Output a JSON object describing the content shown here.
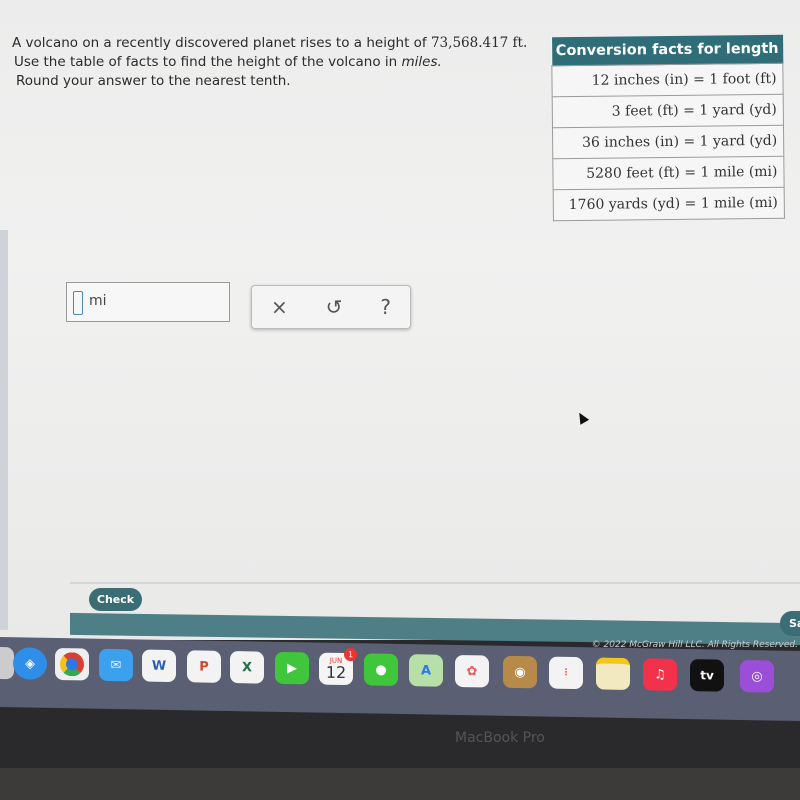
{
  "question": {
    "line1_pre": "A volcano on a recently discovered planet rises to a height of ",
    "height": "73,568.417 ft.",
    "line2_pre": "Use the table of facts to find the height of the volcano in ",
    "line2_unit": "miles.",
    "line3": "Round your answer to the nearest tenth."
  },
  "table": {
    "header": "Conversion facts for length",
    "rows": [
      "12 inches (in) = 1 foot (ft)",
      "3 feet (ft) = 1 yard (yd)",
      "36 inches (in) = 1 yard (yd)",
      "5280 feet (ft) = 1 mile (mi)",
      "1760 yards (yd) = 1 mile (mi)"
    ]
  },
  "answer": {
    "value": "",
    "unit": "mi"
  },
  "tools": {
    "clear": "×",
    "undo": "↺",
    "help": "?"
  },
  "footer": {
    "check_label": "Check",
    "save_label": "Sa",
    "copyright": "© 2022 McGraw Hill LLC. All Rights Reserved."
  },
  "dock": {
    "calendar_month": "JUN",
    "calendar_day": "12",
    "calendar_badge": "1",
    "tv_label": "tv",
    "apps": [
      "finder",
      "safari",
      "chrome",
      "mail",
      "word",
      "powerpoint",
      "excel",
      "facetime",
      "calendar",
      "messages",
      "maps",
      "photos",
      "contacts",
      "reminders",
      "notes",
      "music",
      "apple-tv",
      "podcasts"
    ]
  },
  "device": {
    "brand": "MacBook Pro"
  },
  "colors": {
    "accent": "#3a6e74",
    "table_header": "#2f6e78"
  }
}
